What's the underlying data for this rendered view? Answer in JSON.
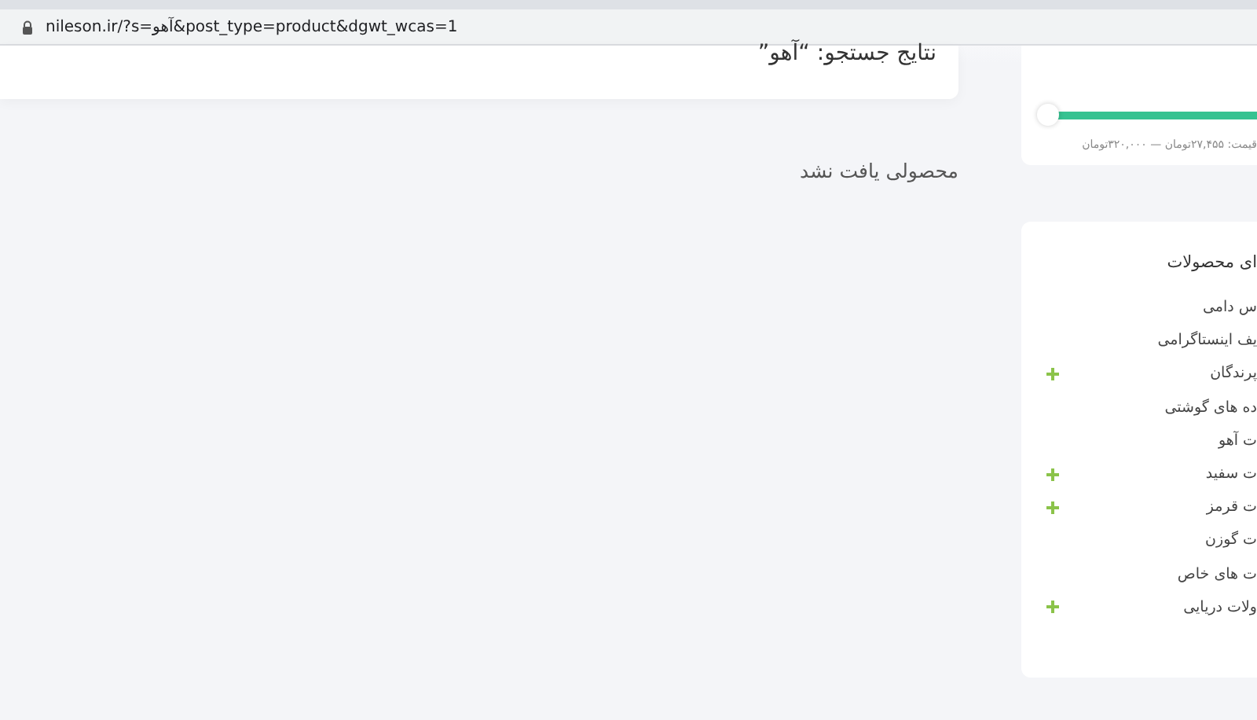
{
  "address_bar": {
    "url": "nileson.ir/?s=آهو&post_type=product&dgwt_wcas=1"
  },
  "search_header": {
    "title": "نتایج جستجو: “آهو”"
  },
  "empty_message": "محصولی یافت نشد",
  "price_filter": {
    "reading": "قیمت: ۲۷,۴۵۵تومان — ۳۲۰,۰۰۰تومان"
  },
  "categories": {
    "title": "ای محصولات",
    "items": [
      {
        "label": "س دامی",
        "kind": "plain"
      },
      {
        "label": "یف اینستاگرامی",
        "kind": "plain"
      },
      {
        "label": "پرندگان",
        "kind": "expandable"
      },
      {
        "label": "ده های گوشتی",
        "kind": "plain"
      },
      {
        "label": "ت آهو",
        "kind": "plain"
      },
      {
        "label": "ت سفید",
        "kind": "expandable"
      },
      {
        "label": "ت قرمز",
        "kind": "expandable"
      },
      {
        "label": "ت گوزن",
        "kind": "plain"
      },
      {
        "label": "ت های خاص",
        "kind": "plain"
      },
      {
        "label": "ولات دریایی",
        "kind": "expandable"
      }
    ]
  }
}
